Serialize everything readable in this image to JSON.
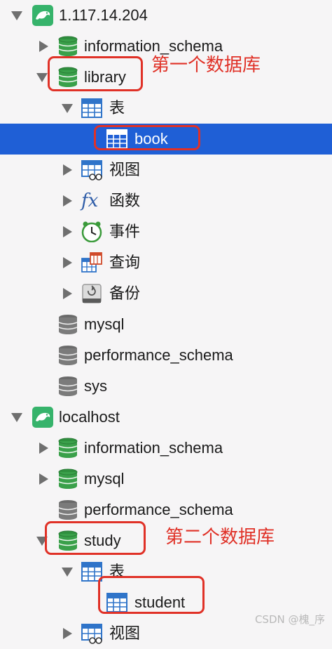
{
  "tree": {
    "rows": [
      {
        "label": "1.117.14.204"
      },
      {
        "label": "information_schema"
      },
      {
        "label": "library"
      },
      {
        "label": "表"
      },
      {
        "label": "book"
      },
      {
        "label": "视图"
      },
      {
        "label": "函数"
      },
      {
        "label": "事件"
      },
      {
        "label": "查询"
      },
      {
        "label": "备份"
      },
      {
        "label": "mysql"
      },
      {
        "label": "performance_schema"
      },
      {
        "label": "sys"
      },
      {
        "label": "localhost"
      },
      {
        "label": "information_schema"
      },
      {
        "label": "mysql"
      },
      {
        "label": "performance_schema"
      },
      {
        "label": "study"
      },
      {
        "label": "表"
      },
      {
        "label": "student"
      },
      {
        "label": "视图"
      }
    ]
  },
  "annotations": {
    "first_db": "第一个数据库",
    "second_db": "第二个数据库"
  },
  "watermark": "CSDN @槐_序",
  "colors": {
    "selection": "#1f5fd6",
    "annotation": "#e03127",
    "db_active": "#3aa04a",
    "db_inactive": "#7b7b7b",
    "server": "#36b36b"
  }
}
